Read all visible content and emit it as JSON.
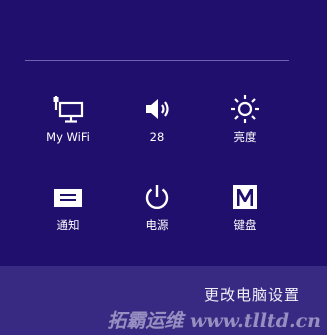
{
  "colors": {
    "background": "#210f6d",
    "bottom_bar": "#382a82",
    "divider": "#6f62ad",
    "text": "#ffffff"
  },
  "tiles": [
    {
      "icon": "wifi-network-icon",
      "label": "My WiFi"
    },
    {
      "icon": "volume-icon",
      "label": "28"
    },
    {
      "icon": "brightness-icon",
      "label": "亮度"
    },
    {
      "icon": "notification-icon",
      "label": "通知"
    },
    {
      "icon": "power-icon",
      "label": "电源"
    },
    {
      "icon": "keyboard-icon",
      "label": "键盘"
    }
  ],
  "bottom_bar": {
    "change_pc_settings": "更改电脑设置"
  },
  "watermark": "拓霸运维 www.tlltd.cn"
}
